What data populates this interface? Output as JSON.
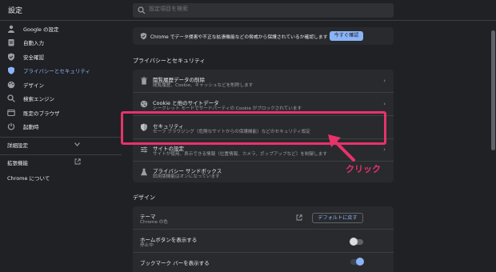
{
  "app": {
    "title": "設定"
  },
  "search": {
    "placeholder": "設定項目を検索"
  },
  "sidebar": {
    "items": [
      {
        "label": "Google の設定",
        "icon": "person-icon"
      },
      {
        "label": "自動入力",
        "icon": "clipboard-icon"
      },
      {
        "label": "安全確認",
        "icon": "shield-check-icon"
      },
      {
        "label": "プライバシーとセキュリティ",
        "icon": "shield-icon",
        "active": true
      },
      {
        "label": "デザイン",
        "icon": "palette-icon"
      },
      {
        "label": "検索エンジン",
        "icon": "search-icon"
      },
      {
        "label": "既定のブラウザ",
        "icon": "browser-icon"
      },
      {
        "label": "起動時",
        "icon": "power-icon"
      }
    ],
    "advanced": {
      "label": "詳細設定"
    },
    "extensions": {
      "label": "拡張機能"
    },
    "about": {
      "label": "Chrome について"
    }
  },
  "safety_banner": {
    "text": "Chrome でデータ侵害や不正な拡張機能などの脅威から保護されているか確認します",
    "button": "今すぐ確認"
  },
  "privacy": {
    "section_title": "プライバシーとセキュリティ",
    "rows": [
      {
        "title": "閲覧履歴データの削除",
        "subtitle": "閲覧履歴、Cookie、キャッシュなどを削除します",
        "icon": "trash-icon"
      },
      {
        "title": "Cookie と他のサイトデータ",
        "subtitle": "シークレット モードでサードパーティの Cookie がブロックされています",
        "icon": "cookie-icon"
      },
      {
        "title": "セキュリティ",
        "subtitle": "セーフ ブラウジング（危険なサイトからの保護機能）などのセキュリティ設定",
        "icon": "shield-icon"
      },
      {
        "title": "サイトの設定",
        "subtitle": "サイトが使用、表示できる情報（位置情報、カメラ、ポップアップなど）を制御します",
        "icon": "sliders-icon"
      },
      {
        "title": "プライバシー サンドボックス",
        "subtitle": "試用版機能はオンになっています",
        "icon": "flask-icon"
      }
    ]
  },
  "design": {
    "section_title": "デザイン",
    "theme": {
      "title": "テーマ",
      "subtitle": "Chrome の色",
      "button": "デフォルトに戻す"
    },
    "home_button": {
      "title": "ホームボタンを表示する",
      "subtitle": "停止中",
      "enabled": false
    },
    "bookmarks_bar": {
      "title": "ブックマーク バーを表示する",
      "enabled": true
    }
  },
  "annotation": {
    "label": "クリック",
    "color": "#e8326b"
  },
  "colors": {
    "accent": "#8ab4f8",
    "background": "#202124",
    "card": "#292a2d"
  }
}
